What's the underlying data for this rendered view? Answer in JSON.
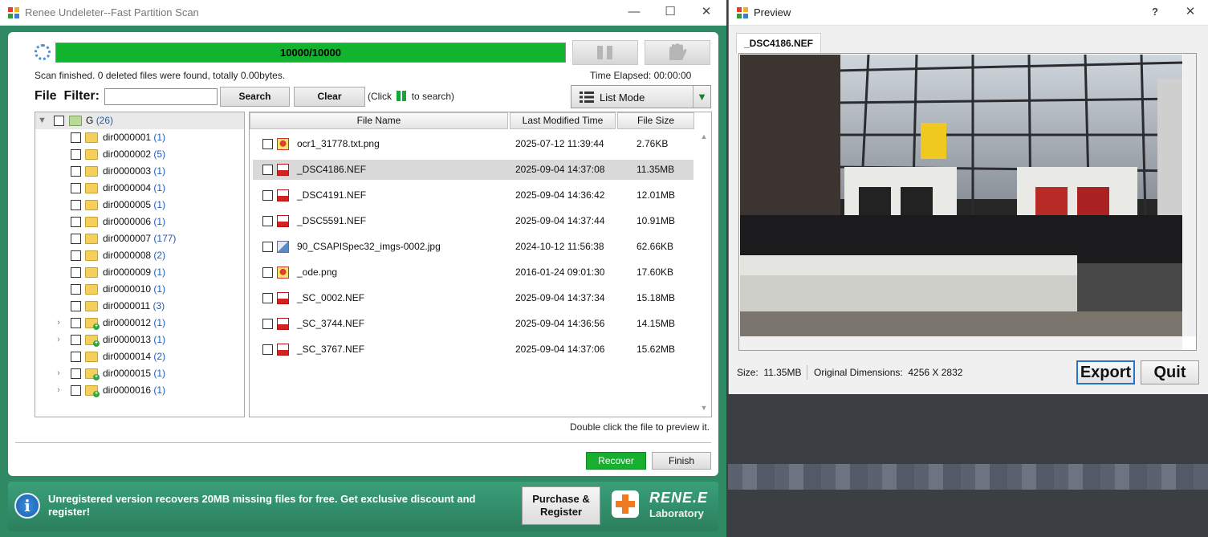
{
  "main_window": {
    "title": "Renee Undeleter--Fast Partition Scan",
    "minimize_glyph": "—",
    "maximize_glyph": "☐",
    "close_glyph": "✕"
  },
  "scan": {
    "progress_text": "10000/10000",
    "progress_fraction": 1.0,
    "status": "Scan finished. 0 deleted files were found, totally 0.00bytes.",
    "elapsed": "Time Elapsed: 00:00:00"
  },
  "filter": {
    "label": "File  Filter:",
    "value": "",
    "search_label": "Search",
    "clear_label": "Clear",
    "hint_before": "(Click",
    "hint_after": "to search)"
  },
  "view_mode": {
    "label": "List Mode"
  },
  "tree": {
    "root": {
      "name": "G",
      "count": "(26)"
    },
    "folders": [
      {
        "name": "dir0000001",
        "count": "(1)",
        "expandable": false
      },
      {
        "name": "dir0000002",
        "count": "(5)",
        "expandable": false
      },
      {
        "name": "dir0000003",
        "count": "(1)",
        "expandable": false
      },
      {
        "name": "dir0000004",
        "count": "(1)",
        "expandable": false
      },
      {
        "name": "dir0000005",
        "count": "(1)",
        "expandable": false
      },
      {
        "name": "dir0000006",
        "count": "(1)",
        "expandable": false
      },
      {
        "name": "dir0000007",
        "count": "(177)",
        "expandable": false
      },
      {
        "name": "dir0000008",
        "count": "(2)",
        "expandable": false
      },
      {
        "name": "dir0000009",
        "count": "(1)",
        "expandable": false
      },
      {
        "name": "dir0000010",
        "count": "(1)",
        "expandable": false
      },
      {
        "name": "dir0000011",
        "count": "(3)",
        "expandable": false
      },
      {
        "name": "dir0000012",
        "count": "(1)",
        "expandable": true
      },
      {
        "name": "dir0000013",
        "count": "(1)",
        "expandable": true
      },
      {
        "name": "dir0000014",
        "count": "(2)",
        "expandable": false
      },
      {
        "name": "dir0000015",
        "count": "(1)",
        "expandable": true
      },
      {
        "name": "dir0000016",
        "count": "(1)",
        "expandable": true
      }
    ]
  },
  "file_list": {
    "columns": [
      "File Name",
      "Last Modified Time",
      "File Size"
    ],
    "rows": [
      {
        "name": "ocr1_31778.txt.png",
        "modified": "2025-07-12 11:39:44",
        "size": "2.76KB",
        "icon": "png-icon",
        "selected": false
      },
      {
        "name": "_DSC4186.NEF",
        "modified": "2025-09-04 14:37:08",
        "size": "11.35MB",
        "icon": "nef-icon",
        "selected": true
      },
      {
        "name": "_DSC4191.NEF",
        "modified": "2025-09-04 14:36:42",
        "size": "12.01MB",
        "icon": "nef-icon",
        "selected": false
      },
      {
        "name": "_DSC5591.NEF",
        "modified": "2025-09-04 14:37:44",
        "size": "10.91MB",
        "icon": "nef-icon",
        "selected": false
      },
      {
        "name": "90_CSAPISpec32_imgs-0002.jpg",
        "modified": "2024-10-12 11:56:38",
        "size": "62.66KB",
        "icon": "jpg-icon",
        "selected": false
      },
      {
        "name": "_ode.png",
        "modified": "2016-01-24 09:01:30",
        "size": "17.60KB",
        "icon": "png-icon",
        "selected": false
      },
      {
        "name": "_SC_0002.NEF",
        "modified": "2025-09-04 14:37:34",
        "size": "15.18MB",
        "icon": "nef-icon",
        "selected": false
      },
      {
        "name": "_SC_3744.NEF",
        "modified": "2025-09-04 14:36:56",
        "size": "14.15MB",
        "icon": "nef-icon",
        "selected": false
      },
      {
        "name": "_SC_3767.NEF",
        "modified": "2025-09-04 14:37:06",
        "size": "15.62MB",
        "icon": "nef-icon",
        "selected": false
      }
    ]
  },
  "hints": {
    "double_click": "Double click the file to preview it."
  },
  "actions": {
    "recover_label": "Recover",
    "finish_label": "Finish"
  },
  "banner": {
    "text": "Unregistered version recovers 20MB missing files for free. Get exclusive discount and register!",
    "purchase_line1": "Purchase &",
    "purchase_line2": "Register",
    "brand_name": "RENE.E",
    "brand_sub": "Laboratory"
  },
  "preview_window": {
    "title": "Preview",
    "help_glyph": "?",
    "close_glyph": "✕",
    "tab_label": "_DSC4186.NEF",
    "size_text": "Size:  11.35MB",
    "dimensions_text": "Original Dimensions:  4256 X 2832",
    "export_label": "Export",
    "quit_label": "Quit"
  },
  "colors": {
    "window_green": "#2f8a63",
    "progress_green": "#12b32f",
    "recover_green": "#18ae2f",
    "count_blue": "#1f5bb5",
    "export_border": "#2a73c7"
  }
}
